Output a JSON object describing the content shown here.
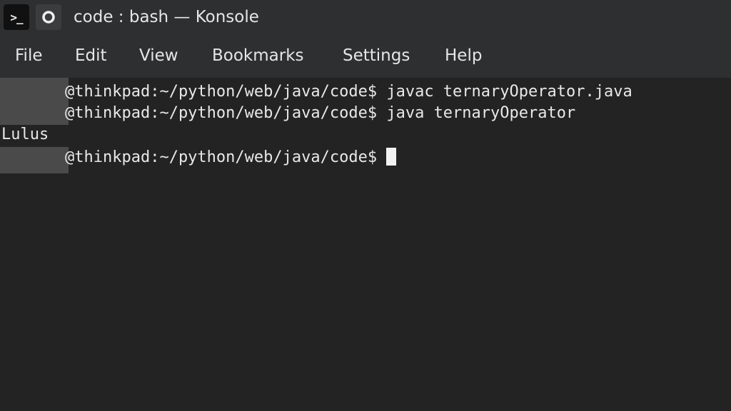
{
  "window": {
    "title": "code : bash — Konsole",
    "app_icon_glyph": ">_",
    "pin_icon": "pin-icon"
  },
  "menu": {
    "items": [
      "File",
      "Edit",
      "View",
      "Bookmarks",
      "Settings",
      "Help"
    ]
  },
  "terminal": {
    "lines": [
      {
        "prompt": "@thinkpad:~/python/web/java/code$",
        "command": " javac ternaryOperator.java"
      },
      {
        "prompt": "@thinkpad:~/python/web/java/code$",
        "command": " java ternaryOperator"
      },
      {
        "output": "Lulus"
      },
      {
        "prompt": "@thinkpad:~/python/web/java/code$",
        "command": " "
      }
    ],
    "colors": {
      "background": "#232323",
      "foreground": "#e8e8e8",
      "redaction": "#4a4a4a"
    }
  }
}
